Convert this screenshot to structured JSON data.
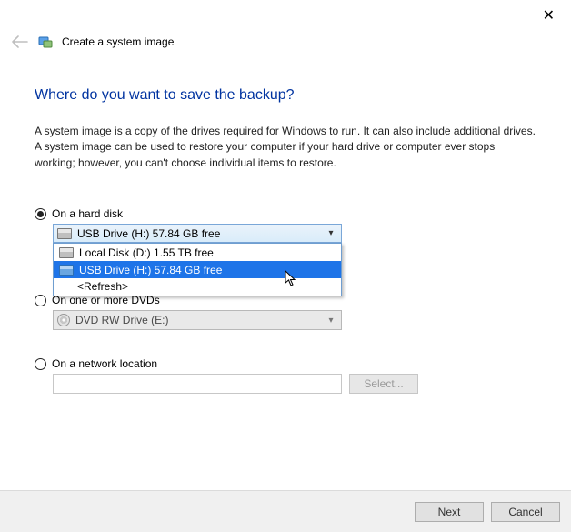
{
  "window": {
    "title": "Create a system image"
  },
  "headline": "Where do you want to save the backup?",
  "description": "A system image is a copy of the drives required for Windows to run. It can also include additional drives. A system image can be used to restore your computer if your hard drive or computer ever stops working; however, you can't choose individual items to restore.",
  "options": {
    "hard_disk": {
      "label": "On a hard disk"
    },
    "dvd": {
      "label": "On one or more DVDs"
    },
    "network": {
      "label": "On a network location"
    }
  },
  "disk_combo": {
    "selected": "USB Drive (H:)  57.84 GB free",
    "items": [
      "Local Disk (D:)  1.55 TB free",
      "USB Drive (H:)  57.84 GB free"
    ],
    "refresh": "<Refresh>"
  },
  "dvd_combo": {
    "selected": "DVD RW Drive (E:)"
  },
  "buttons": {
    "select": "Select...",
    "next": "Next",
    "cancel": "Cancel"
  }
}
